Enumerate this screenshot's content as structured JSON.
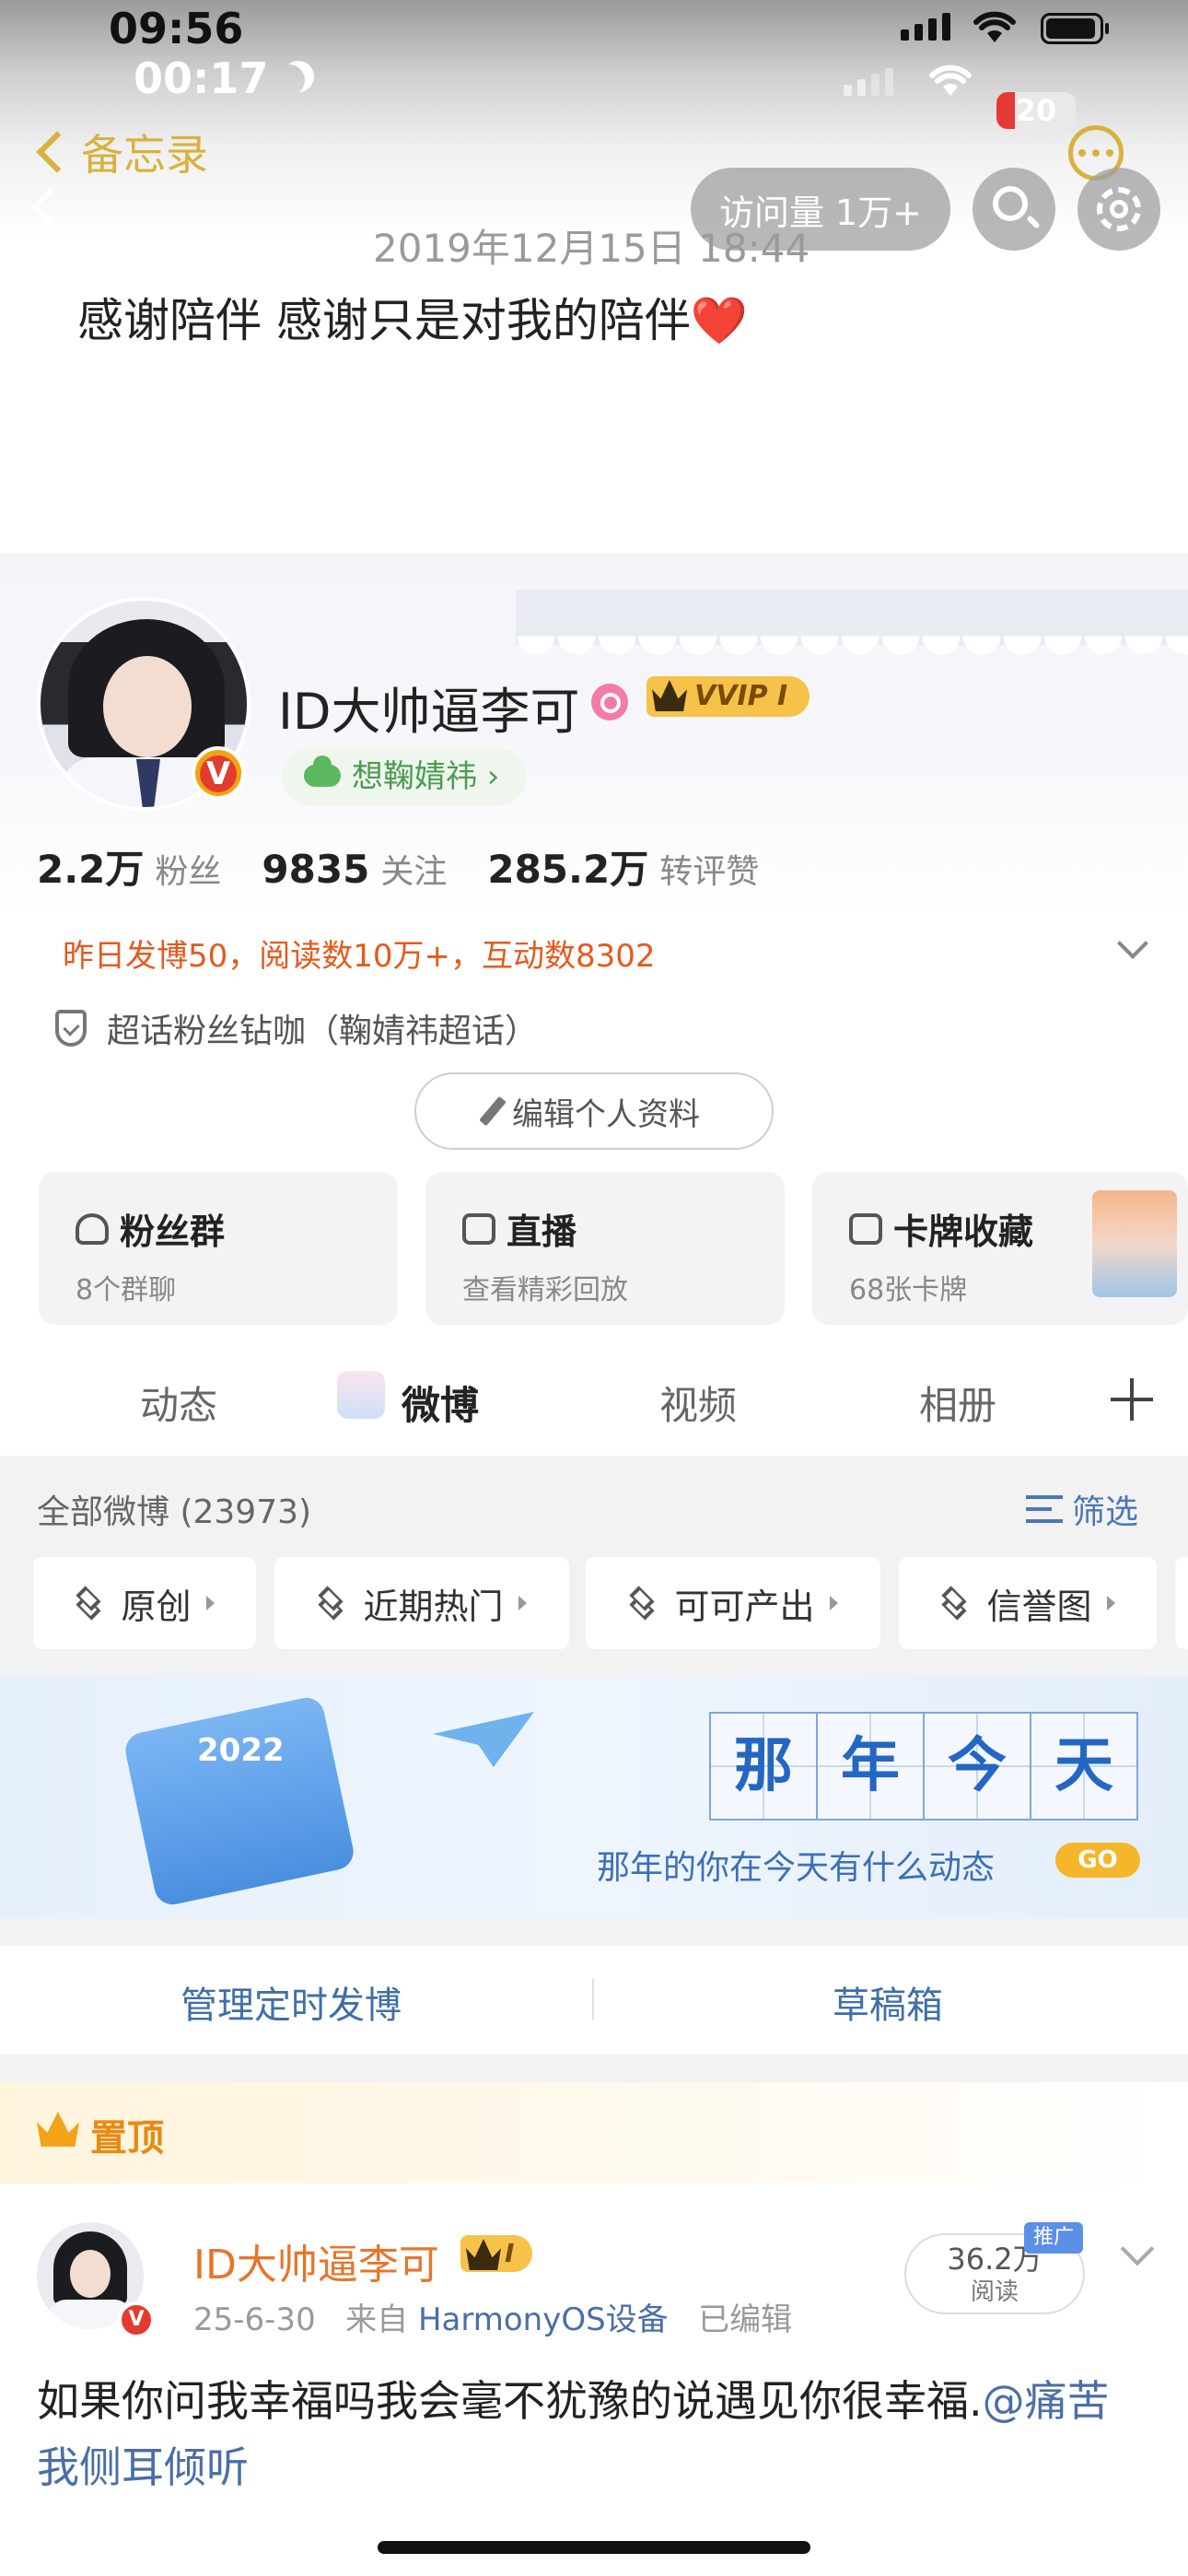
{
  "status_bar": {
    "time_primary": "09:56",
    "time_secondary": "00:17",
    "battery_level": "20"
  },
  "nav": {
    "back_label": "备忘录",
    "visits_label": "访问量 1万+"
  },
  "memo": {
    "date": "2019年12月15日 18:44",
    "text": "感谢陪伴 感谢只是对我的陪伴❤️"
  },
  "profile": {
    "username": "ID大帅逼李可",
    "vip_label": "VVIP I",
    "verified_letter": "V",
    "cp_tag": "想鞠婧祎 ›",
    "stats": [
      {
        "value": "2.2万",
        "label": "粉丝"
      },
      {
        "value": "9835",
        "label": "关注"
      },
      {
        "value": "285.2万",
        "label": "转评赞"
      }
    ],
    "highlight": "昨日发博50，阅读数10万+，互动数8302",
    "supertopic": "超话粉丝钻咖（鞠婧祎超话）",
    "edit_button": "编辑个人资料"
  },
  "cards": [
    {
      "title": "粉丝群",
      "sub": "8个群聊"
    },
    {
      "title": "直播",
      "sub": "查看精彩回放"
    },
    {
      "title": "卡牌收藏",
      "sub": "68张卡牌"
    }
  ],
  "tabs": [
    "动态",
    "微博",
    "视频",
    "相册"
  ],
  "feed": {
    "all_label": "全部微博 (23973)",
    "filter_label": "筛选",
    "chips": [
      "原创",
      "近期热门",
      "可可产出",
      "信誉图"
    ]
  },
  "banner": {
    "year": "2022",
    "title_chars": [
      "那",
      "年",
      "今",
      "天"
    ],
    "subtitle": "那年的你在今天有什么动态",
    "go": "GO"
  },
  "actions": {
    "scheduled": "管理定时发博",
    "drafts": "草稿箱"
  },
  "pinned": {
    "label": "置顶",
    "author": "ID大帅逼李可",
    "vip_label": "I",
    "date": "25-6-30",
    "source_prefix": "来自",
    "source": "HarmonyOS设备",
    "edited": "已编辑",
    "reads_value": "36.2万",
    "reads_label": "阅读",
    "promo": "推广",
    "text_main": "如果你问我幸福吗我会毫不犹豫的说遇见你很幸福.",
    "text_mention": "@痛苦我侧耳倾听"
  },
  "colors": {
    "accent_orange": "#e45a1d",
    "link_blue": "#4a6ea8",
    "gold": "#d8b23c",
    "vip_gold": "#f6c24a"
  }
}
